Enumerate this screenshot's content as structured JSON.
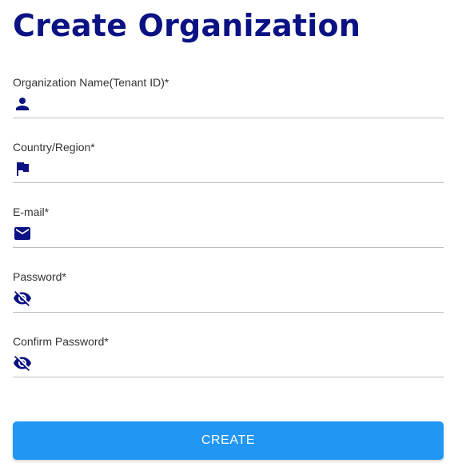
{
  "page": {
    "title": "Create Organization"
  },
  "form": {
    "fields": [
      {
        "label": "Organization Name(Tenant ID)*",
        "value": "",
        "placeholder": "",
        "icon": "person-icon"
      },
      {
        "label": "Country/Region*",
        "value": "",
        "placeholder": "",
        "icon": "flag-icon"
      },
      {
        "label": "E-mail*",
        "value": "",
        "placeholder": "",
        "icon": "envelope-icon"
      },
      {
        "label": "Password*",
        "value": "",
        "placeholder": "",
        "icon": "eye-off-icon"
      },
      {
        "label": "Confirm Password*",
        "value": "",
        "placeholder": "",
        "icon": "eye-off-icon"
      }
    ],
    "submit_label": "CREATE"
  },
  "colors": {
    "title": "#0b1283",
    "icon": "#0b1283",
    "button": "#2196f3",
    "button_text": "#ffffff",
    "underline": "#bdbdbd"
  }
}
